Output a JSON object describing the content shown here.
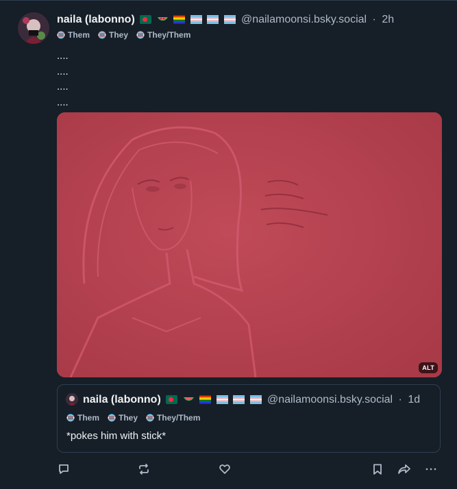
{
  "post": {
    "display_name": "naila (labonno)",
    "handle": "@nailamoonsi.bsky.social",
    "separator": "·",
    "time": "2h",
    "pronouns": [
      "Them",
      "They",
      "They/Them"
    ],
    "body_lines": [
      "....",
      "....",
      "....",
      "...."
    ],
    "image": {
      "alt_badge": "ALT"
    }
  },
  "quote": {
    "display_name": "naila (labonno)",
    "handle": "@nailamoonsi.bsky.social",
    "separator": "·",
    "time": "1d",
    "pronouns": [
      "Them",
      "They",
      "They/Them"
    ],
    "text": "*pokes him with stick*"
  },
  "actions": {
    "reply_icon": "reply-icon",
    "repost_icon": "repost-icon",
    "like_icon": "heart-icon",
    "bookmark_icon": "bookmark-icon",
    "share_icon": "share-icon",
    "more_icon": "more-icon"
  },
  "colors": {
    "background": "#161e27",
    "border": "#2e4052",
    "muted_text": "#aebbc9",
    "text": "#f1f3f5",
    "image_tint": "#b4424f"
  }
}
